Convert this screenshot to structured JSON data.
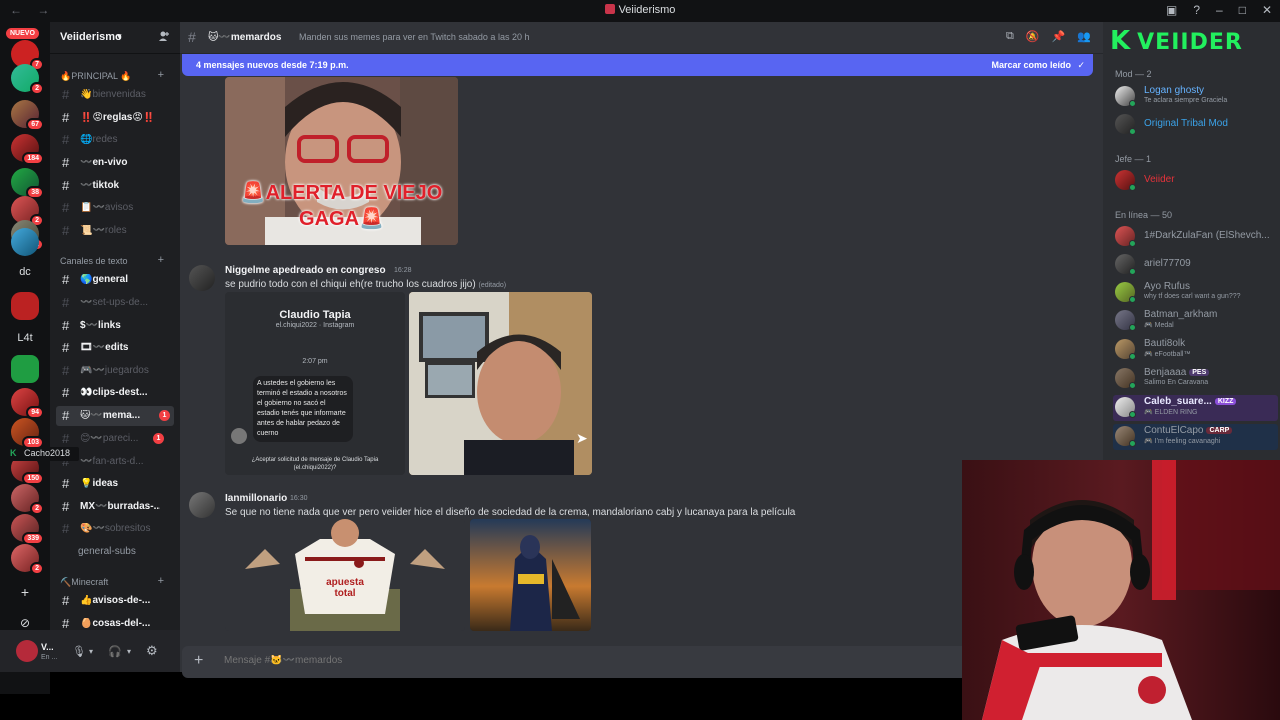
{
  "window": {
    "title": "Veiiderismo",
    "nav": "← →"
  },
  "servers": {
    "new_pill": "NUEVO",
    "badges": [
      "7",
      "2",
      "67",
      "184",
      "38",
      "2",
      "21",
      "2",
      "2",
      "94",
      "103",
      "150",
      "339",
      "2"
    ],
    "text_icons": [
      "dc",
      "L4t"
    ]
  },
  "guild": {
    "name": "Veiiderismo"
  },
  "categories": {
    "principal": "🔥PRINCIPAL 🔥",
    "texto": "Canales de texto",
    "minecraft": "⛏️Minecraft"
  },
  "channels": [
    {
      "name": "👋bienvenidas"
    },
    {
      "name": "‼️😡reglas😡‼️"
    },
    {
      "name": "🌐redes"
    },
    {
      "name": "〰️en-vivo"
    },
    {
      "name": "〰️tiktok"
    },
    {
      "name": "📋〰️avisos"
    },
    {
      "name": "📜〰️roles"
    },
    {
      "name": "🌎general"
    },
    {
      "name": "〰️set-ups-de..."
    },
    {
      "name": "$〰️links"
    },
    {
      "name": "🎞〰️edits"
    },
    {
      "name": "🎮〰️juegardos"
    },
    {
      "name": "👀clips-dest..."
    },
    {
      "name": "🐱〰️mema...",
      "badge": "1"
    },
    {
      "name": "😊〰️pareci...",
      "badge": "1"
    },
    {
      "name": "〰️fan-arts-d..."
    },
    {
      "name": "💡ideas"
    },
    {
      "name": "MX〰️burradas-..."
    },
    {
      "name": "🎨〰️sobresitos"
    },
    {
      "name": "general-subs"
    },
    {
      "name": "👍avisos-de-..."
    },
    {
      "name": "🥚cosas-del-..."
    }
  ],
  "hover_tip": "Cacho2018",
  "user_panel": {
    "name": "V...",
    "status": "En ..."
  },
  "header": {
    "channel": "🐱〰️memardos",
    "topic": "Manden sus memes para ver en Twitch sabado a las 20 h"
  },
  "new_messages": {
    "text": "4 mensajes nuevos desde 7:19 p.m.",
    "mark_read": "Marcar como leído"
  },
  "messages": [
    {
      "author": "Niggelme apedreado en congreso",
      "time": "16:28",
      "text": "se pudrio todo con el chiqui eh(re trucho los cuadros jijo)",
      "edited": "(editado)"
    },
    {
      "author": "Ianmillonario",
      "time": "16:30",
      "text": "Se que no tiene nada que ver pero veiider hice el diseño de sociedad de la crema, mandaloriano cabj y lucanaya para la película"
    }
  ],
  "meme_caption": {
    "line1": "🚨ALERTA DE VIEJO",
    "line2": "GAGA🚨"
  },
  "ig_screenshot": {
    "name": "Claudio Tapia",
    "handle": "el.chiqui2022 · Instagram",
    "time": "2:07 pm",
    "message": "A ustedes el gobierno les terminó el estadio a nosotros el gobierno no sacó el estadio tenés que informarte antes de hablar pedazo de cuerno",
    "footer1": "¿Aceptar solicitud de mensaje de Claudio Tapia",
    "footer2": "(el.chiqui2022)?"
  },
  "jersey_text": "apuesta total",
  "composer": {
    "placeholder": "Mensaje #🐱〰️memardos"
  },
  "members": {
    "groups": {
      "mod": "Mod — 2",
      "jefe": "Jefe — 1",
      "online": "En línea — 50"
    },
    "mods": [
      {
        "name": "Logan ghosty",
        "sub": "Te aclara siempre Graciela",
        "color": "#66b3ff"
      },
      {
        "name": "Original Tribal Mod",
        "sub": "",
        "color": "#3ba2e8"
      }
    ],
    "jefe": [
      {
        "name": "Veiider",
        "color": "#e5323a"
      }
    ],
    "online": [
      {
        "name": "1#DarkZulaFan (ElShevch...",
        "sub": ""
      },
      {
        "name": "ariel77709",
        "sub": ""
      },
      {
        "name": "Ayo Rufus",
        "sub": "why tf does carl want a gun???"
      },
      {
        "name": "Batman_arkham",
        "sub": "🎮 Medal"
      },
      {
        "name": "Bauti8olk",
        "sub": "🎮 eFootball™"
      },
      {
        "name": "Benjaaaa",
        "sub": "Salimo En Caravana",
        "tag": "PES"
      },
      {
        "name": "Caleb_suare...",
        "sub": "🎮 ELDEN RING",
        "tag": "KIZZ"
      },
      {
        "name": "ContuElCapo",
        "sub": "🎮 I'm feeling cavanaghi",
        "tag": "CARP"
      }
    ]
  },
  "logo_text": "VEIIDER",
  "colors": {
    "accent": "#5865f2",
    "danger": "#f23f43",
    "online": "#23a55a",
    "logo": "#22f05e"
  }
}
